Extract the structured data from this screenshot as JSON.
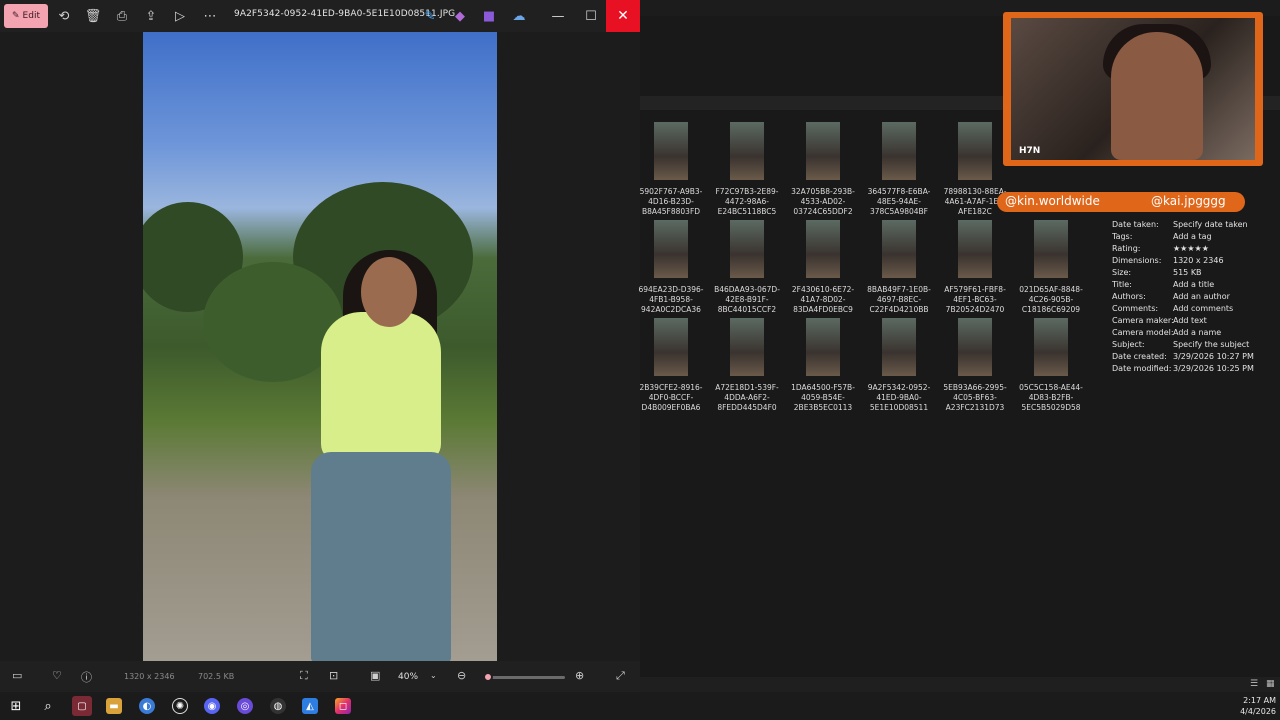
{
  "viewer": {
    "edit_label": "Edit",
    "file_name": "9A2F5342-0952-41ED-9BA0-5E1E10D08511.JPG",
    "close_glyph": "✕",
    "minimize_glyph": "—",
    "maximize_glyph": "☐",
    "toolbar_icons": [
      "rotate-icon",
      "delete-icon",
      "print-icon",
      "share-icon",
      "slideshow-icon",
      "more-icon"
    ],
    "dimensions": "1320 x 2346",
    "file_size": "702.5 KB",
    "zoom": "40%",
    "zoom_level": 0.05,
    "accent_color": "#f4a3b0"
  },
  "thumbnails": [
    {
      "label": "5902F767-A9B3-4D16-B23D-B8A45F8803FD"
    },
    {
      "label": "F72C97B3-2E89-4472-98A6-E24BC5118BC5"
    },
    {
      "label": "32A705B8-293B-4533-AD02-03724C65DDF2"
    },
    {
      "label": "364577F8-E6BA-48E5-94AE-378C5A9804BF"
    },
    {
      "label": "78988130-88EA-4A61-A7AF-1E... AFE182C"
    },
    {
      "label": "694EA23D-D396-4FB1-B958-942A0C2DCA36"
    },
    {
      "label": "B46DAA93-067D-42E8-B91F-8BC44015CCF2"
    },
    {
      "label": "2F430610-6E72-41A7-8D02-83DA4FD0EBC9"
    },
    {
      "label": "8BAB49F7-1E0B-4697-B8EC-C22F4D4210BB"
    },
    {
      "label": "AF579F61-FBF8-4EF1-BC63-7B20524D2470"
    },
    {
      "label": "021D65AF-8848-4C26-905B-C18186C69209"
    },
    {
      "label": "2B39CFE2-8916-4DF0-BCCF-D4B009EF0BA6"
    },
    {
      "label": "A72E18D1-539F-4DDA-A6F2-8FEDD445D4F0"
    },
    {
      "label": "1DA64500-F57B-4059-B54E-2BE3B5EC0113"
    },
    {
      "label": "9A2F5342-0952-41ED-9BA0-5E1E10D08511"
    },
    {
      "label": "5EB93A66-2995-4C05-BF63-A23FC2131D73"
    },
    {
      "label": "05C5C158-AE44-4D83-B2FB-5EC5B5029D58"
    }
  ],
  "details": [
    {
      "key": "Date taken:",
      "value": "Specify date taken"
    },
    {
      "key": "Tags:",
      "value": "Add a tag"
    },
    {
      "key": "Rating:",
      "value": "★★★★★"
    },
    {
      "key": "Dimensions:",
      "value": "1320 x 2346"
    },
    {
      "key": "Size:",
      "value": "515 KB"
    },
    {
      "key": "Title:",
      "value": "Add a title"
    },
    {
      "key": "Authors:",
      "value": "Add an author"
    },
    {
      "key": "Comments:",
      "value": "Add comments"
    },
    {
      "key": "Camera maker:",
      "value": "Add text"
    },
    {
      "key": "Camera model:",
      "value": "Add a name"
    },
    {
      "key": "Subject:",
      "value": "Specify the subject"
    },
    {
      "key": "Date created:",
      "value": "3/29/2026 10:27 PM"
    },
    {
      "key": "Date modified:",
      "value": "3/29/2026 10:25 PM"
    }
  ],
  "overlay": {
    "cam_logo": "H7N",
    "handle_1": "@kin.worldwide",
    "handle_2": "@kai.jpgggg",
    "frame_color": "#e0661a"
  },
  "taskbar": {
    "apps": [
      "start-icon",
      "search-icon",
      "app-icon",
      "file-explorer-icon",
      "browser-icon",
      "chatgpt-icon",
      "discord-icon",
      "obs-icon",
      "chrome-icon",
      "photos-icon",
      "instagram-icon"
    ],
    "time": "2:17 AM",
    "date": "4/4/2026"
  }
}
